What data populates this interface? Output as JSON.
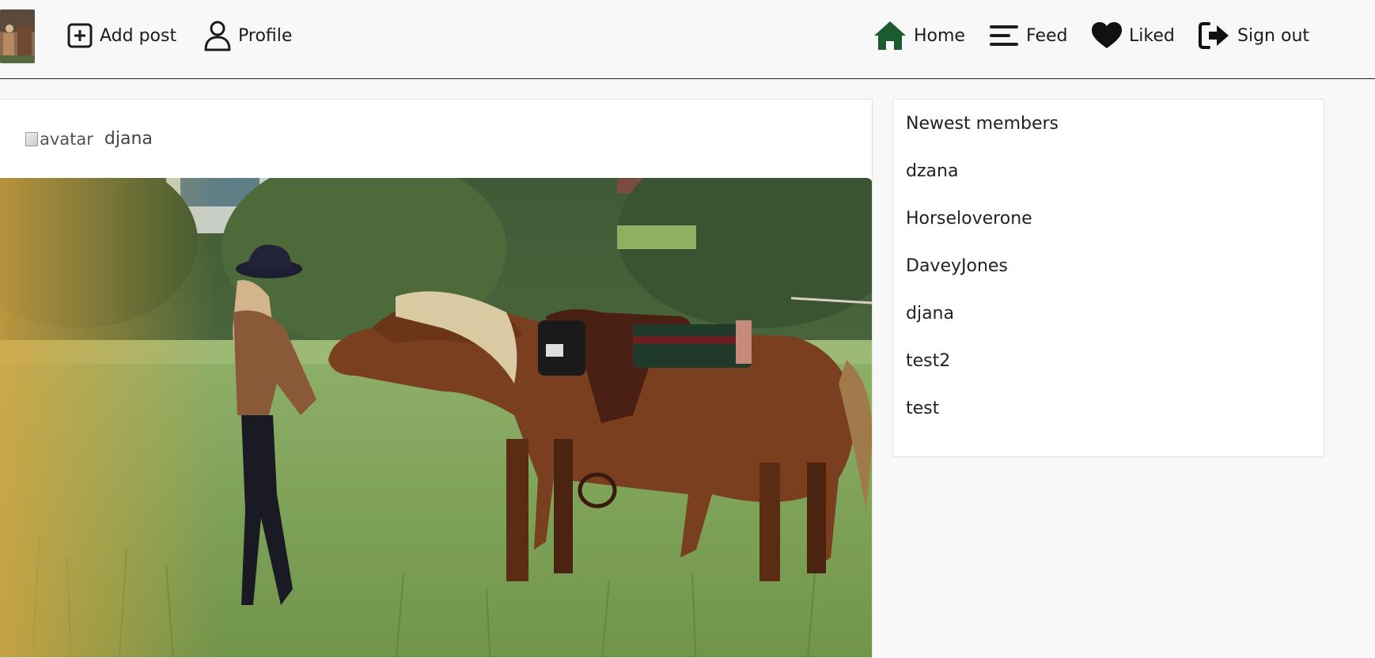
{
  "nav": {
    "add_post_label": "Add post",
    "profile_label": "Profile",
    "home_label": "Home",
    "feed_label": "Feed",
    "liked_label": "Liked",
    "signout_label": "Sign out",
    "home_icon_color": "#1a5c2e"
  },
  "post": {
    "avatar_alt": "avatar",
    "author": "djana"
  },
  "sidebar": {
    "title": "Newest members",
    "members": [
      "dzana",
      "Horseloverone",
      "DaveyJones",
      "djana",
      "test2",
      "test"
    ]
  }
}
